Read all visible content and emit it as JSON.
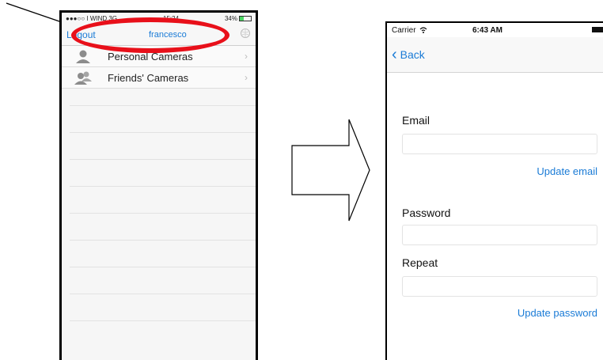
{
  "left_phone": {
    "status": {
      "carrier": "●●●○○ I WIND  3G",
      "time": "15:24",
      "battery": "34%"
    },
    "nav": {
      "logout_label": "Logout",
      "title": "francesco",
      "globe_icon": "globe-icon"
    },
    "rows": [
      {
        "label": "Personal Cameras",
        "icon": "single-person-icon"
      },
      {
        "label": "Friends' Cameras",
        "icon": "two-persons-icon"
      }
    ],
    "chevron": "›"
  },
  "right_phone": {
    "status": {
      "carrier": "Carrier",
      "time": "6:43 AM"
    },
    "nav": {
      "back_label": "Back",
      "back_chevron": "‹"
    },
    "form": {
      "email_label": "Email",
      "update_email_label": "Update email",
      "password_label": "Password",
      "repeat_label": "Repeat",
      "update_password_label": "Update password"
    }
  },
  "colors": {
    "ios_blue": "#1a7bd6",
    "highlight_red": "#e8101a"
  }
}
